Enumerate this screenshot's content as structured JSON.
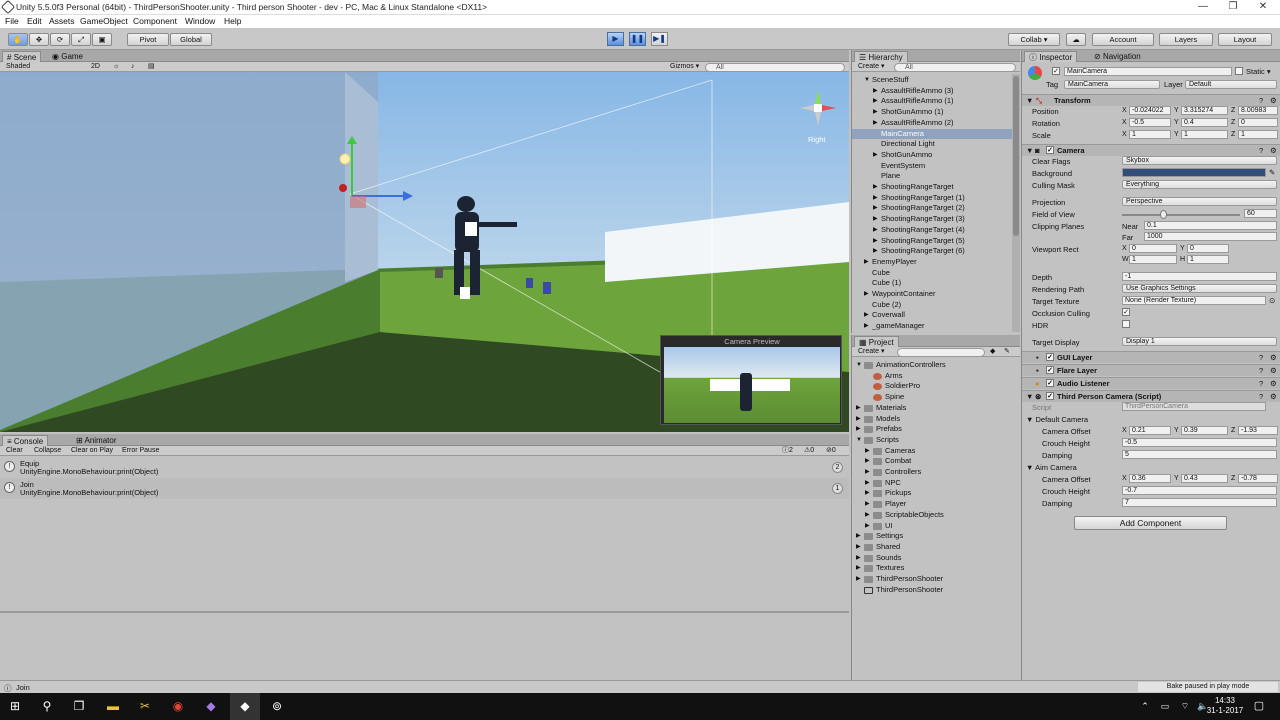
{
  "titlebar": {
    "title": "Unity 5.5.0f3 Personal (64bit) - ThirdPersonShooter.unity - Third person Shooter - dev - PC, Mac & Linux Standalone <DX11>",
    "min": "—",
    "max": "❐",
    "close": "✕"
  },
  "menu": [
    "File",
    "Edit",
    "Assets",
    "GameObject",
    "Component",
    "Window",
    "Help"
  ],
  "toolbar": {
    "pivot": "Pivot",
    "global": "Global",
    "collab": "Collab ▾",
    "account": "Account",
    "layers": "Layers",
    "layout": "Layout"
  },
  "scene": {
    "tab_scene": "Scene",
    "tab_game": "Game",
    "shaded": "Shaded",
    "twod": "2D",
    "gizmos": "Gizmos ▾",
    "search_placeholder": "All",
    "axis_label": "Right",
    "camera_preview": "Camera Preview"
  },
  "console": {
    "tab": "Console",
    "tab_animator": "Animator",
    "clear": "Clear",
    "collapse": "Collapse",
    "clear_on_play": "Clear on Play",
    "error_pause": "Error Pause",
    "badge_info": "2",
    "badge_warn": "0",
    "badge_err": "0",
    "rows": [
      {
        "line1": "Equip",
        "line2": "UnityEngine.MonoBehaviour:print(Object)",
        "count": "2"
      },
      {
        "line1": "Join",
        "line2": "UnityEngine.MonoBehaviour:print(Object)",
        "count": "1"
      }
    ]
  },
  "hierarchy": {
    "tab": "Hierarchy",
    "create": "Create ▾",
    "search_placeholder": "All",
    "items": [
      {
        "label": "SceneStuff",
        "indent": 0,
        "arrow": "▼"
      },
      {
        "label": "AssaultRifleAmmo (3)",
        "indent": 1,
        "arrow": "▶"
      },
      {
        "label": "AssaultRifleAmmo (1)",
        "indent": 1,
        "arrow": "▶"
      },
      {
        "label": "ShotGunAmmo (1)",
        "indent": 1,
        "arrow": "▶"
      },
      {
        "label": "AssaultRifleAmmo (2)",
        "indent": 1,
        "arrow": "▶"
      },
      {
        "label": "MainCamera",
        "indent": 1,
        "arrow": "",
        "sel": true
      },
      {
        "label": "Directional Light",
        "indent": 1,
        "arrow": ""
      },
      {
        "label": "ShotGunAmmo",
        "indent": 1,
        "arrow": "▶"
      },
      {
        "label": "EventSystem",
        "indent": 1,
        "arrow": ""
      },
      {
        "label": "Plane",
        "indent": 1,
        "arrow": ""
      },
      {
        "label": "ShootingRangeTarget",
        "indent": 1,
        "arrow": "▶"
      },
      {
        "label": "ShootingRangeTarget (1)",
        "indent": 1,
        "arrow": "▶"
      },
      {
        "label": "ShootingRangeTarget (2)",
        "indent": 1,
        "arrow": "▶"
      },
      {
        "label": "ShootingRangeTarget (3)",
        "indent": 1,
        "arrow": "▶"
      },
      {
        "label": "ShootingRangeTarget (4)",
        "indent": 1,
        "arrow": "▶"
      },
      {
        "label": "ShootingRangeTarget (5)",
        "indent": 1,
        "arrow": "▶"
      },
      {
        "label": "ShootingRangeTarget (6)",
        "indent": 1,
        "arrow": "▶"
      },
      {
        "label": "EnemyPlayer",
        "indent": 0,
        "arrow": "▶"
      },
      {
        "label": "Cube",
        "indent": 0,
        "arrow": ""
      },
      {
        "label": "Cube (1)",
        "indent": 0,
        "arrow": ""
      },
      {
        "label": "WaypointContainer",
        "indent": 0,
        "arrow": "▶"
      },
      {
        "label": "Cube (2)",
        "indent": 0,
        "arrow": ""
      },
      {
        "label": "Coverwall",
        "indent": 0,
        "arrow": "▶"
      },
      {
        "label": "_gameManager",
        "indent": 0,
        "arrow": "▶"
      }
    ]
  },
  "project": {
    "tab": "Project",
    "create": "Create ▾",
    "items": [
      {
        "label": "AnimationControllers",
        "indent": 0,
        "arrow": "▼",
        "kind": "folder"
      },
      {
        "label": "Arms",
        "indent": 1,
        "arrow": "",
        "kind": "asset"
      },
      {
        "label": "SoldierPro",
        "indent": 1,
        "arrow": "",
        "kind": "asset"
      },
      {
        "label": "Spine",
        "indent": 1,
        "arrow": "",
        "kind": "asset"
      },
      {
        "label": "Materials",
        "indent": 0,
        "arrow": "▶",
        "kind": "folder"
      },
      {
        "label": "Models",
        "indent": 0,
        "arrow": "▶",
        "kind": "folder"
      },
      {
        "label": "Prefabs",
        "indent": 0,
        "arrow": "▶",
        "kind": "folder"
      },
      {
        "label": "Scripts",
        "indent": 0,
        "arrow": "▼",
        "kind": "folder"
      },
      {
        "label": "Cameras",
        "indent": 1,
        "arrow": "▶",
        "kind": "folder"
      },
      {
        "label": "Combat",
        "indent": 1,
        "arrow": "▶",
        "kind": "folder"
      },
      {
        "label": "Controllers",
        "indent": 1,
        "arrow": "▶",
        "kind": "folder"
      },
      {
        "label": "NPC",
        "indent": 1,
        "arrow": "▶",
        "kind": "folder"
      },
      {
        "label": "Pickups",
        "indent": 1,
        "arrow": "▶",
        "kind": "folder"
      },
      {
        "label": "Player",
        "indent": 1,
        "arrow": "▶",
        "kind": "folder"
      },
      {
        "label": "ScriptableObjects",
        "indent": 1,
        "arrow": "▶",
        "kind": "folder"
      },
      {
        "label": "UI",
        "indent": 1,
        "arrow": "▶",
        "kind": "folder"
      },
      {
        "label": "Settings",
        "indent": 0,
        "arrow": "▶",
        "kind": "folder"
      },
      {
        "label": "Shared",
        "indent": 0,
        "arrow": "▶",
        "kind": "folder"
      },
      {
        "label": "Sounds",
        "indent": 0,
        "arrow": "▶",
        "kind": "folder"
      },
      {
        "label": "Textures",
        "indent": 0,
        "arrow": "▶",
        "kind": "folder"
      },
      {
        "label": "ThirdPersonShooter",
        "indent": 0,
        "arrow": "▶",
        "kind": "folder"
      },
      {
        "label": "ThirdPersonShooter",
        "indent": 0,
        "arrow": "",
        "kind": "scene"
      }
    ]
  },
  "inspector": {
    "tab": "Inspector",
    "tab_nav": "Navigation",
    "object_name": "MainCamera",
    "static": "Static ▾",
    "tag_label": "Tag",
    "tag": "MainCamera",
    "layer_label": "Layer",
    "layer": "Default",
    "transform": {
      "title": "Transform",
      "position": "Position",
      "rotation": "Rotation",
      "scale": "Scale",
      "pos": [
        "-0.024022",
        "3.315274",
        "8.00983"
      ],
      "rot": [
        "-0.5",
        "0.4",
        "0"
      ],
      "scl": [
        "1",
        "1",
        "1"
      ]
    },
    "camera": {
      "title": "Camera",
      "clear_flags": "Clear Flags",
      "clear_flags_v": "Skybox",
      "background": "Background",
      "culling_mask": "Culling Mask",
      "culling_mask_v": "Everything",
      "projection": "Projection",
      "projection_v": "Perspective",
      "fov": "Field of View",
      "fov_v": "60",
      "fov_frac": 0.35,
      "clipping": "Clipping Planes",
      "near": "Near",
      "near_v": "0.1",
      "far": "Far",
      "far_v": "1000",
      "viewport": "Viewport Rect",
      "vx": "0",
      "vy": "0",
      "vw": "1",
      "vh": "1",
      "depth": "Depth",
      "depth_v": "-1",
      "rendering_path": "Rendering Path",
      "rendering_path_v": "Use Graphics Settings",
      "target_texture": "Target Texture",
      "target_texture_v": "None (Render Texture)",
      "occlusion": "Occlusion Culling",
      "hdr": "HDR",
      "target_display": "Target Display",
      "target_display_v": "Display 1"
    },
    "gui_layer": "GUI Layer",
    "flare_layer": "Flare Layer",
    "audio_listener": "Audio Listener",
    "tpc": {
      "title": "Third Person Camera (Script)",
      "script": "Script",
      "script_v": "ThirdPersonCamera",
      "default_camera": "Default Camera",
      "camera_offset": "Camera Offset",
      "crouch_height": "Crouch Height",
      "damping": "Damping",
      "def_offset": [
        "0.21",
        "0.39",
        "-1.93"
      ],
      "def_crouch": "-0.5",
      "def_damping": "5",
      "aim_camera": "Aim Camera",
      "aim_offset": [
        "0.36",
        "0.43",
        "-0.78"
      ],
      "aim_crouch": "-0.7",
      "aim_damping": "7"
    },
    "add_component": "Add Component"
  },
  "statusbar": {
    "text": "Join",
    "bake": "Bake paused in play mode"
  },
  "taskbar": {
    "time": "14:33",
    "date": "31-1-2017"
  }
}
